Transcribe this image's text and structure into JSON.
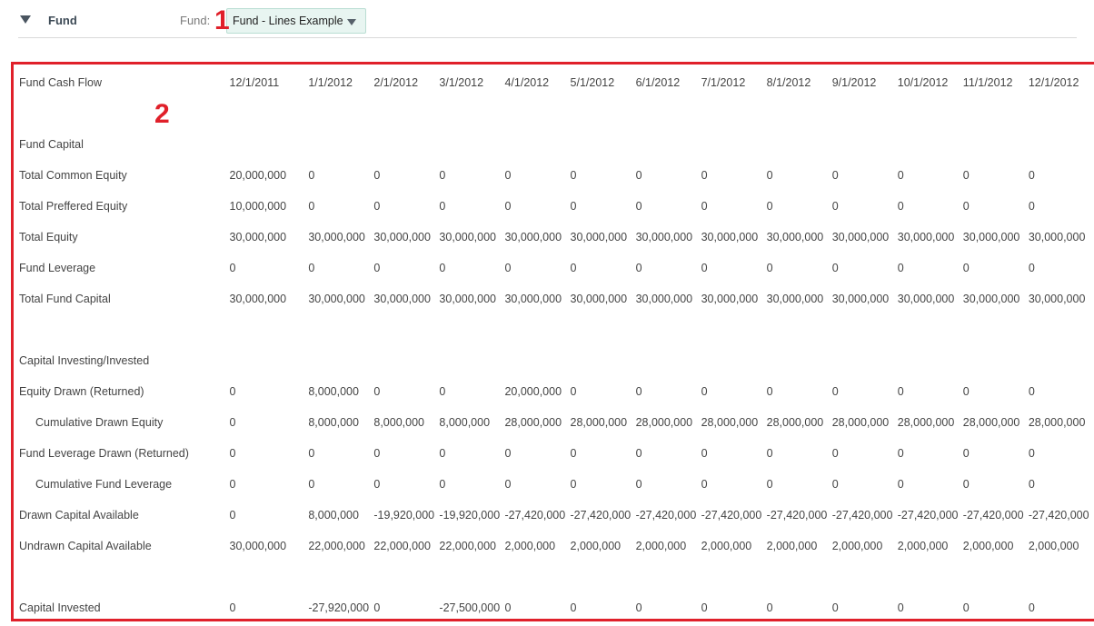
{
  "section": {
    "title": "Fund",
    "caret": "caret-down-icon"
  },
  "fund_selector": {
    "label": "Fund:",
    "selected": "Fund - Lines Example",
    "caret": "caret-down-icon"
  },
  "markers": {
    "one": "1",
    "two": "2"
  },
  "colors": {
    "marker": "#e0202a",
    "select_bg": "#e8f5f1"
  },
  "table": {
    "header_label": "Fund Cash Flow",
    "dates": [
      "12/1/2011",
      "1/1/2012",
      "2/1/2012",
      "3/1/2012",
      "4/1/2012",
      "5/1/2012",
      "6/1/2012",
      "7/1/2012",
      "8/1/2012",
      "9/1/2012",
      "10/1/2012",
      "11/1/2012",
      "12/1/2012"
    ],
    "rows": [
      {
        "label": "",
        "values": []
      },
      {
        "label": "Fund Capital",
        "values": []
      },
      {
        "label": "Total Common Equity",
        "values": [
          "20,000,000",
          "0",
          "0",
          "0",
          "0",
          "0",
          "0",
          "0",
          "0",
          "0",
          "0",
          "0",
          "0"
        ]
      },
      {
        "label": "Total Preffered Equity",
        "values": [
          "10,000,000",
          "0",
          "0",
          "0",
          "0",
          "0",
          "0",
          "0",
          "0",
          "0",
          "0",
          "0",
          "0"
        ]
      },
      {
        "label": "Total Equity",
        "values": [
          "30,000,000",
          "30,000,000",
          "30,000,000",
          "30,000,000",
          "30,000,000",
          "30,000,000",
          "30,000,000",
          "30,000,000",
          "30,000,000",
          "30,000,000",
          "30,000,000",
          "30,000,000",
          "30,000,000"
        ]
      },
      {
        "label": "Fund Leverage",
        "values": [
          "0",
          "0",
          "0",
          "0",
          "0",
          "0",
          "0",
          "0",
          "0",
          "0",
          "0",
          "0",
          "0"
        ]
      },
      {
        "label": "Total Fund Capital",
        "values": [
          "30,000,000",
          "30,000,000",
          "30,000,000",
          "30,000,000",
          "30,000,000",
          "30,000,000",
          "30,000,000",
          "30,000,000",
          "30,000,000",
          "30,000,000",
          "30,000,000",
          "30,000,000",
          "30,000,000"
        ]
      },
      {
        "label": "",
        "values": []
      },
      {
        "label": "Capital Investing/Invested",
        "values": []
      },
      {
        "label": "Equity Drawn (Returned)",
        "values": [
          "0",
          "8,000,000",
          "0",
          "0",
          "20,000,000",
          "0",
          "0",
          "0",
          "0",
          "0",
          "0",
          "0",
          "0"
        ]
      },
      {
        "label": "Cumulative Drawn Equity",
        "indent": true,
        "values": [
          "0",
          "8,000,000",
          "8,000,000",
          "8,000,000",
          "28,000,000",
          "28,000,000",
          "28,000,000",
          "28,000,000",
          "28,000,000",
          "28,000,000",
          "28,000,000",
          "28,000,000",
          "28,000,000"
        ]
      },
      {
        "label": "Fund Leverage Drawn (Returned)",
        "values": [
          "0",
          "0",
          "0",
          "0",
          "0",
          "0",
          "0",
          "0",
          "0",
          "0",
          "0",
          "0",
          "0"
        ]
      },
      {
        "label": "Cumulative Fund Leverage",
        "indent": true,
        "values": [
          "0",
          "0",
          "0",
          "0",
          "0",
          "0",
          "0",
          "0",
          "0",
          "0",
          "0",
          "0",
          "0"
        ]
      },
      {
        "label": "Drawn Capital Available",
        "values": [
          "0",
          "8,000,000",
          "-19,920,000",
          "-19,920,000",
          "-27,420,000",
          "-27,420,000",
          "-27,420,000",
          "-27,420,000",
          "-27,420,000",
          "-27,420,000",
          "-27,420,000",
          "-27,420,000",
          "-27,420,000"
        ]
      },
      {
        "label": "Undrawn Capital Available",
        "values": [
          "30,000,000",
          "22,000,000",
          "22,000,000",
          "22,000,000",
          "2,000,000",
          "2,000,000",
          "2,000,000",
          "2,000,000",
          "2,000,000",
          "2,000,000",
          "2,000,000",
          "2,000,000",
          "2,000,000"
        ]
      },
      {
        "label": "",
        "values": []
      },
      {
        "label": "Capital Invested",
        "values": [
          "0",
          "-27,920,000",
          "0",
          "-27,500,000",
          "0",
          "0",
          "0",
          "0",
          "0",
          "0",
          "0",
          "0",
          "0"
        ]
      }
    ]
  }
}
